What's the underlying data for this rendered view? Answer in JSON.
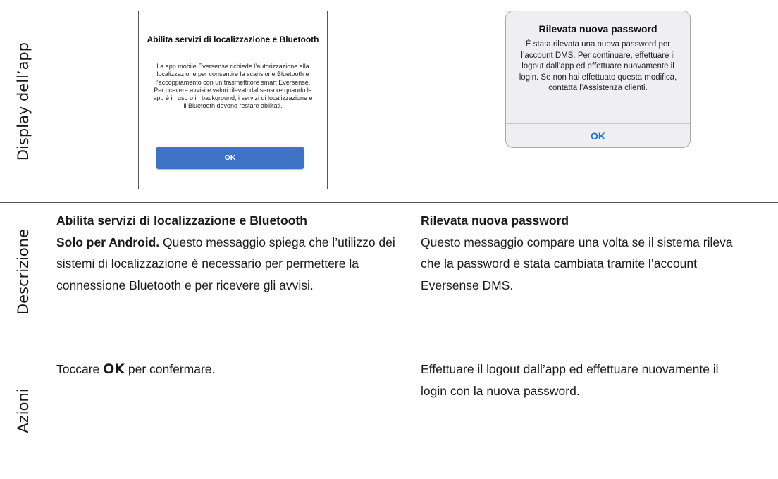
{
  "row_headers": {
    "display": "Display dell’app",
    "description": "Descrizione",
    "actions": "Azioni"
  },
  "android_dialog": {
    "title": "Abilita servizi di localizzazione e Bluetooth",
    "body": "La app mobile Eversense richiede l’autorizzazione alla localizzazione per consentire la scansione Bluetooth e l’accoppiamento con un trasmettitore smart Eversense. Per ricevere avvisi e valori rilevati dal sensore quando la app è in uso o in background, i servizi di localizzazione e il Bluetooth devono restare abilitati.",
    "button": "OK"
  },
  "ios_alert": {
    "title": "Rilevata nuova password",
    "body": "È stata rilevata una nuova password per l’account DMS. Per continuare, effettuare il logout dall’app ed effettuare nuovamente il login. Se non hai effettuato questa modifica, contatta l’Assistenza clienti.",
    "button": "OK"
  },
  "descriptions": {
    "left": {
      "title": "Abilita servizi di localizzazione e Bluetooth",
      "lead": "Solo per Android.",
      "text": " Questo messaggio spiega che l’utilizzo dei sistemi di localizzazione è necessario per permettere la connessione Bluetooth e per ricevere gli avvisi."
    },
    "right": {
      "title": "Rilevata nuova password",
      "text": "Questo messaggio compare una volta se il sistema rileva che la password è stata cambiata tramite l’account Eversense DMS."
    }
  },
  "actions": {
    "left": {
      "pre": "Toccare ",
      "emph": "OK",
      "post": " per confermare."
    },
    "right": {
      "text": "Effettuare il logout dall’app ed effettuare nuovamente il login con la nuova password."
    }
  }
}
